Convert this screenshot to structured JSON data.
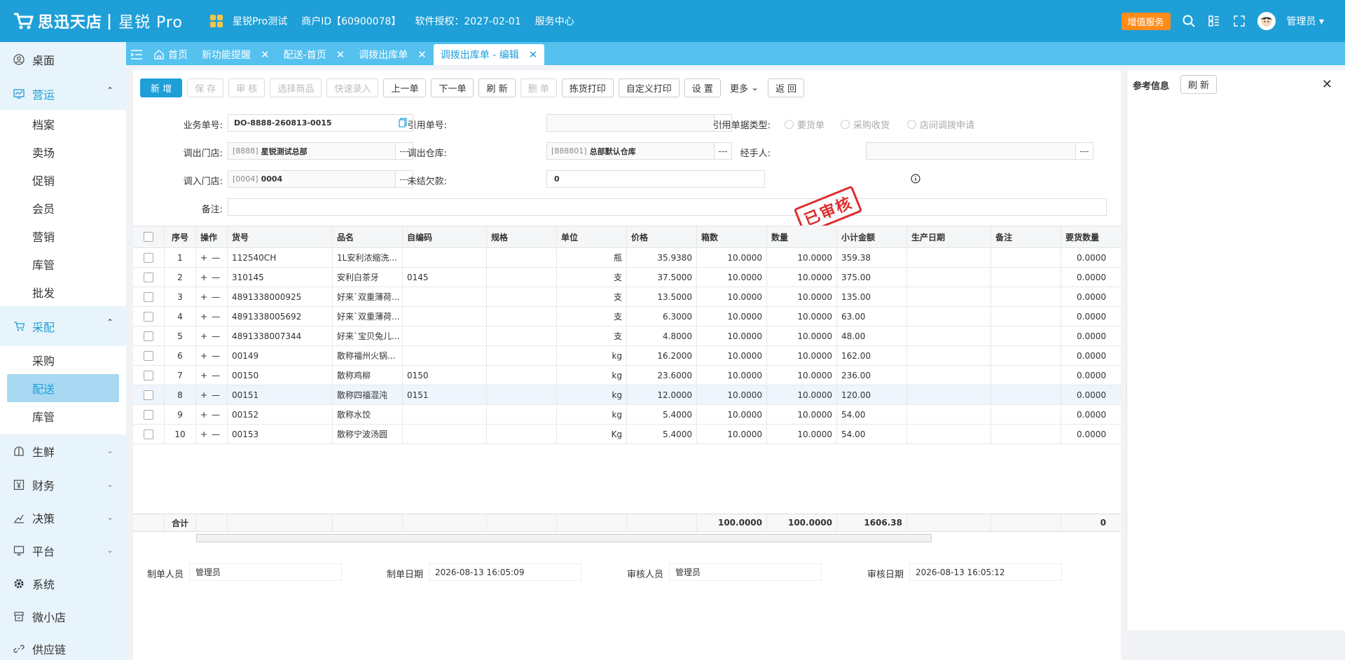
{
  "header": {
    "brand": "思迅天店",
    "product": "星锐 Pro",
    "store_name": "星锐Pro测试",
    "merchant_id": "商户ID【60900078】",
    "license": "软件授权：2027-02-01",
    "service_center": "服务中心",
    "value_added": "增值服务",
    "user": "管理员",
    "accent": "#1e9fd8"
  },
  "sidebar": {
    "desktop": "桌面",
    "ops": "营运",
    "ops_items": [
      "档案",
      "卖场",
      "促销",
      "会员",
      "营销",
      "库管",
      "批发"
    ],
    "purchase": "采配",
    "purchase_items": [
      "采购",
      "配送",
      "库管"
    ],
    "fresh": "生鲜",
    "finance": "财务",
    "decision": "决策",
    "platform": "平台",
    "system": "系统",
    "mini_store": "微小店",
    "supply_chain": "供应链"
  },
  "tabs": [
    "首页",
    "新功能提醒",
    "配送-首页",
    "调拨出库单",
    "调拨出库单 - 编辑"
  ],
  "toolbar": {
    "new": "新 增",
    "save": "保 存",
    "audit": "审 核",
    "select_goods": "选择商品",
    "quick_entry": "快速录入",
    "prev": "上一单",
    "next": "下一单",
    "refresh": "刷 新",
    "delete": "删 单",
    "pick_print": "拣货打印",
    "custom_print": "自定义打印",
    "settings": "设 置",
    "more": "更多",
    "back": "返 回"
  },
  "form": {
    "doc_no_label": "业务单号:",
    "doc_no": "DO-8888-260813-0015",
    "ref_no_label": "引用单号:",
    "ref_type_label": "引用单据类型:",
    "ref_types": [
      "要货单",
      "采购收货",
      "店间调拨申请"
    ],
    "out_store_label": "调出门店:",
    "out_store_code": "[8888]",
    "out_store_name": "星锐测试总部",
    "out_wh_label": "调出仓库:",
    "out_wh_code": "[888801]",
    "out_wh_name": "总部默认仓库",
    "handler_label": "经手人:",
    "in_store_label": "调入门店:",
    "in_store_code": "[0004]",
    "in_store_name": "0004",
    "debt_label": "未结欠款:",
    "debt": "0",
    "remark_label": "备注:",
    "stamp": "已审核"
  },
  "table": {
    "headers": [
      "序号",
      "操作",
      "货号",
      "品名",
      "自编码",
      "规格",
      "单位",
      "价格",
      "箱数",
      "数量",
      "小计金额",
      "生产日期",
      "备注",
      "要货数量"
    ],
    "rows": [
      [
        "1",
        "112540CH",
        "1L安利浓缩洗...",
        "",
        "",
        "瓶",
        "35.9380",
        "10.0000",
        "10.0000",
        "359.38",
        "",
        "",
        "0.0000"
      ],
      [
        "2",
        "310145",
        "安利白茶牙",
        "0145",
        "",
        "支",
        "37.5000",
        "10.0000",
        "10.0000",
        "375.00",
        "",
        "",
        "0.0000"
      ],
      [
        "3",
        "4891338000925",
        "好来`双重薄荷...",
        "",
        "",
        "支",
        "13.5000",
        "10.0000",
        "10.0000",
        "135.00",
        "",
        "",
        "0.0000"
      ],
      [
        "4",
        "4891338005692",
        "好来`双重薄荷...",
        "",
        "",
        "支",
        "6.3000",
        "10.0000",
        "10.0000",
        "63.00",
        "",
        "",
        "0.0000"
      ],
      [
        "5",
        "4891338007344",
        "好来`宝贝兔儿...",
        "",
        "",
        "支",
        "4.8000",
        "10.0000",
        "10.0000",
        "48.00",
        "",
        "",
        "0.0000"
      ],
      [
        "6",
        "00149",
        "散称福州火锅...",
        "",
        "",
        "kg",
        "16.2000",
        "10.0000",
        "10.0000",
        "162.00",
        "",
        "",
        "0.0000"
      ],
      [
        "7",
        "00150",
        "散称鸡柳",
        "0150",
        "",
        "kg",
        "23.6000",
        "10.0000",
        "10.0000",
        "236.00",
        "",
        "",
        "0.0000"
      ],
      [
        "8",
        "00151",
        "散称四福混沌",
        "0151",
        "",
        "kg",
        "12.0000",
        "10.0000",
        "10.0000",
        "120.00",
        "",
        "",
        "0.0000"
      ],
      [
        "9",
        "00152",
        "散称水饺",
        "",
        "",
        "kg",
        "5.4000",
        "10.0000",
        "10.0000",
        "54.00",
        "",
        "",
        "0.0000"
      ],
      [
        "10",
        "00153",
        "散称宁波汤圆",
        "",
        "",
        "Kg",
        "5.4000",
        "10.0000",
        "10.0000",
        "54.00",
        "",
        "",
        "0.0000"
      ]
    ],
    "op_plus": "+",
    "op_minus": "—",
    "footer_label": "合计",
    "total_boxes": "100.0000",
    "total_qty": "100.0000",
    "total_amount": "1606.38",
    "total_req": "0"
  },
  "footer": {
    "creator_label": "制单人员",
    "creator": "管理员",
    "create_date_label": "制单日期",
    "create_date": "2026-08-13 16:05:09",
    "auditor_label": "审核人员",
    "auditor": "管理员",
    "audit_date_label": "审核日期",
    "audit_date": "2026-08-13 16:05:12"
  },
  "right_panel": {
    "title": "参考信息",
    "refresh": "刷 新"
  }
}
